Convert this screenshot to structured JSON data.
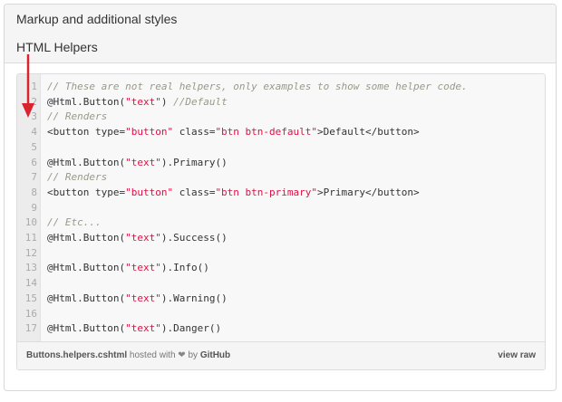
{
  "panel": {
    "title": "Markup and additional styles",
    "subtitle": "HTML Helpers"
  },
  "code": {
    "lines": [
      {
        "n": "1",
        "tokens": [
          {
            "t": "// These are not real helpers, only examples to show some helper code.",
            "c": "comment"
          }
        ]
      },
      {
        "n": "2",
        "tokens": [
          {
            "t": "@Html.Button(",
            "c": "plain"
          },
          {
            "t": "\"text\"",
            "c": "str"
          },
          {
            "t": ") ",
            "c": "plain"
          },
          {
            "t": "//Default",
            "c": "comment"
          }
        ]
      },
      {
        "n": "3",
        "tokens": [
          {
            "t": "// Renders",
            "c": "comment"
          }
        ]
      },
      {
        "n": "4",
        "tokens": [
          {
            "t": "<button type=",
            "c": "plain"
          },
          {
            "t": "\"button\"",
            "c": "str"
          },
          {
            "t": " class=",
            "c": "plain"
          },
          {
            "t": "\"btn btn-default\"",
            "c": "str"
          },
          {
            "t": ">Default</button>",
            "c": "plain"
          }
        ]
      },
      {
        "n": "5",
        "tokens": []
      },
      {
        "n": "6",
        "tokens": [
          {
            "t": "@Html.Button(",
            "c": "plain"
          },
          {
            "t": "\"text\"",
            "c": "str"
          },
          {
            "t": ").Primary()",
            "c": "plain"
          }
        ]
      },
      {
        "n": "7",
        "tokens": [
          {
            "t": "// Renders",
            "c": "comment"
          }
        ]
      },
      {
        "n": "8",
        "tokens": [
          {
            "t": "<button type=",
            "c": "plain"
          },
          {
            "t": "\"button\"",
            "c": "str"
          },
          {
            "t": " class=",
            "c": "plain"
          },
          {
            "t": "\"btn btn-primary\"",
            "c": "str"
          },
          {
            "t": ">Primary</button>",
            "c": "plain"
          }
        ]
      },
      {
        "n": "9",
        "tokens": []
      },
      {
        "n": "10",
        "tokens": [
          {
            "t": "// Etc...",
            "c": "comment"
          }
        ]
      },
      {
        "n": "11",
        "tokens": [
          {
            "t": "@Html.Button(",
            "c": "plain"
          },
          {
            "t": "\"text\"",
            "c": "str"
          },
          {
            "t": ").Success()",
            "c": "plain"
          }
        ]
      },
      {
        "n": "12",
        "tokens": []
      },
      {
        "n": "13",
        "tokens": [
          {
            "t": "@Html.Button(",
            "c": "plain"
          },
          {
            "t": "\"text\"",
            "c": "str"
          },
          {
            "t": ").Info()",
            "c": "plain"
          }
        ]
      },
      {
        "n": "14",
        "tokens": []
      },
      {
        "n": "15",
        "tokens": [
          {
            "t": "@Html.Button(",
            "c": "plain"
          },
          {
            "t": "\"text\"",
            "c": "str"
          },
          {
            "t": ").Warning()",
            "c": "plain"
          }
        ]
      },
      {
        "n": "16",
        "tokens": []
      },
      {
        "n": "17",
        "tokens": [
          {
            "t": "@Html.Button(",
            "c": "plain"
          },
          {
            "t": "\"text\"",
            "c": "str"
          },
          {
            "t": ").Danger()",
            "c": "plain"
          }
        ]
      }
    ]
  },
  "footer": {
    "filename": "Buttons.helpers.cshtml",
    "hosted_with": "hosted with",
    "heart_icon": "heart-icon",
    "by": "by",
    "host": "GitHub",
    "view_raw": "view raw"
  },
  "annotation": {
    "arrow_color": "#d9232d"
  },
  "colors": {
    "comment": "#999988",
    "string": "#dd1144",
    "plain": "#333333"
  }
}
